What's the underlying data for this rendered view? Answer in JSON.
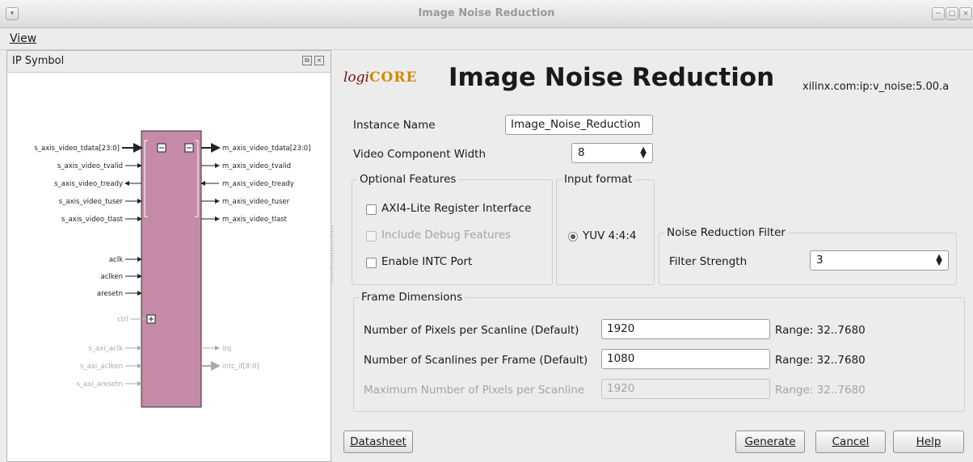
{
  "window": {
    "title": "Image Noise Reduction"
  },
  "menu": {
    "view": "View"
  },
  "left_panel": {
    "title": "IP Symbol",
    "ports_left": [
      "s_axis_video_tdata[23:0]",
      "s_axis_video_tvalid",
      "s_axis_video_tready",
      "s_axis_video_tuser",
      "s_axis_video_tlast",
      "aclk",
      "aclken",
      "aresetn",
      "ctrl",
      "s_axi_aclk",
      "s_axi_aclken",
      "s_axi_aresetn"
    ],
    "ports_right": [
      "m_axis_video_tdata[23:0]",
      "m_axis_video_tvalid",
      "m_axis_video_tready",
      "m_axis_video_tuser",
      "m_axis_video_tlast",
      "irq",
      "intc_if[8:0]"
    ]
  },
  "header": {
    "logo_logi": "logi",
    "logo_core": "CORE",
    "title": "Image Noise Reduction",
    "vlnv": "xilinx.com:ip:v_noise:5.00.a"
  },
  "form": {
    "instance_name_label": "Instance Name",
    "instance_name_value": "Image_Noise_Reduction",
    "component_width_label": "Video Component Width",
    "component_width_value": "8",
    "optional_features": {
      "title": "Optional Features",
      "axi4_lite": "AXI4-Lite Register Interface",
      "debug": "Include Debug Features",
      "intc": "Enable INTC Port"
    },
    "input_format": {
      "title": "Input format",
      "option": "YUV 4:4:4"
    },
    "noise_filter": {
      "title": "Noise Reduction Filter",
      "strength_label": "Filter Strength",
      "strength_value": "3"
    },
    "frame_dimensions": {
      "title": "Frame Dimensions",
      "pixels_label": "Number of Pixels per Scanline (Default)",
      "pixels_value": "1920",
      "pixels_range": "Range: 32..7680",
      "scanlines_label": "Number of Scanlines per Frame (Default)",
      "scanlines_value": "1080",
      "scanlines_range": "Range: 32..7680",
      "max_pixels_label": "Maximum Number of Pixels per Scanline",
      "max_pixels_value": "1920",
      "max_pixels_range": "Range: 32..7680"
    }
  },
  "buttons": {
    "datasheet": "Datasheet",
    "generate": "Generate",
    "cancel": "Cancel",
    "help": "Help"
  },
  "colors": {
    "symbol_body": "#c48aa8",
    "logo_red": "#7a1010",
    "logo_orange": "#d28a00"
  }
}
